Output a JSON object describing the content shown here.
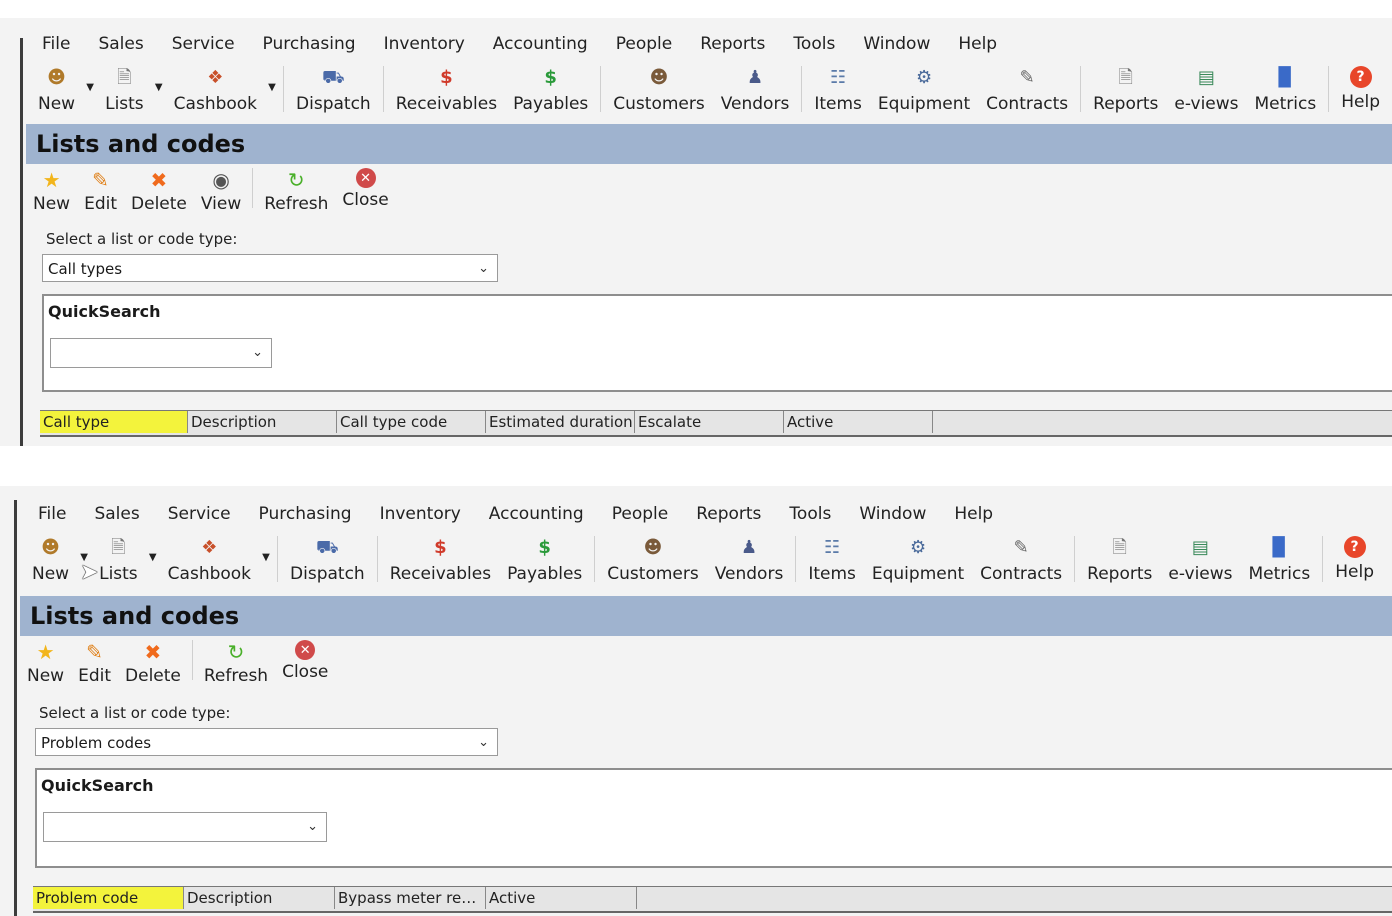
{
  "menu": [
    "File",
    "Sales",
    "Service",
    "Purchasing",
    "Inventory",
    "Accounting",
    "People",
    "Reports",
    "Tools",
    "Window",
    "Help"
  ],
  "toolbar": {
    "new": "New",
    "lists": "Lists",
    "cashbook": "Cashbook",
    "dispatch": "Dispatch",
    "receivables": "Receivables",
    "payables": "Payables",
    "customers": "Customers",
    "vendors": "Vendors",
    "items": "Items",
    "equipment": "Equipment",
    "contracts": "Contracts",
    "reports": "Reports",
    "eviews": "e-views",
    "metrics": "Metrics",
    "help": "Help"
  },
  "panel_title": "Lists and codes",
  "select_label": "Select a list or code type:",
  "quicksearch_label": "QuickSearch",
  "screen1": {
    "actions": {
      "new": "New",
      "edit": "Edit",
      "delete": "Delete",
      "view": "View",
      "refresh": "Refresh",
      "close": "Close"
    },
    "list_type": "Call types",
    "columns": [
      "Call type",
      "Description",
      "Call type code",
      "Estimated duration",
      "Escalate",
      "Active"
    ]
  },
  "screen2": {
    "actions": {
      "new": "New",
      "edit": "Edit",
      "delete": "Delete",
      "refresh": "Refresh",
      "close": "Close"
    },
    "list_type": "Problem codes",
    "columns": [
      "Problem code",
      "Description",
      "Bypass meter re…",
      "Active"
    ]
  },
  "colors": {
    "title_bar": "#9fb3cf",
    "highlight": "#f3f33c"
  }
}
